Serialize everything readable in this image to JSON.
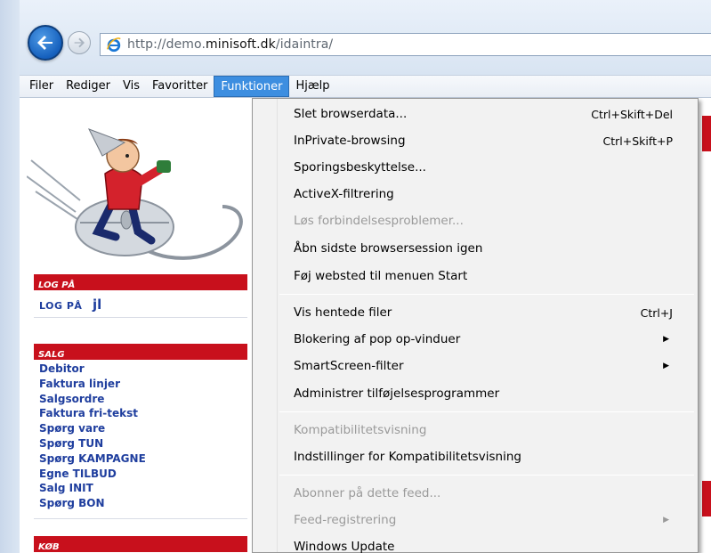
{
  "address": {
    "url_prefix": "http://demo.",
    "url_host": "minisoft.dk",
    "url_path": "/idaintra/"
  },
  "icons": {
    "back": "back-arrow-icon",
    "forward": "forward-arrow-icon",
    "page": "internet-explorer-icon",
    "submenu": "submenu-arrow-icon"
  },
  "menubar": {
    "items": [
      "Filer",
      "Rediger",
      "Vis",
      "Favoritter",
      "Funktioner",
      "Hjælp"
    ],
    "active": "Funktioner"
  },
  "dropdown": {
    "items": [
      {
        "label": "Slet browserdata...",
        "shortcut": "Ctrl+Skift+Del"
      },
      {
        "label": "InPrivate-browsing",
        "shortcut": "Ctrl+Skift+P"
      },
      {
        "label": "Sporingsbeskyttelse..."
      },
      {
        "label": "ActiveX-filtrering"
      },
      {
        "label": "Løs forbindelsesproblemer...",
        "disabled": true
      },
      {
        "label": "Åbn sidste browsersession igen"
      },
      {
        "label": "Føj websted til menuen Start"
      },
      {
        "label": "Vis hentede filer",
        "shortcut": "Ctrl+J"
      },
      {
        "label": "Blokering af pop op-vinduer",
        "submenu": true
      },
      {
        "label": "SmartScreen-filter",
        "submenu": true
      },
      {
        "label": "Administrer tilføjelsesprogrammer"
      },
      {
        "label": "Kompatibilitetsvisning",
        "disabled": true
      },
      {
        "label": "Indstillinger for Kompatibilitetsvisning"
      },
      {
        "label": "Abonner på dette feed...",
        "disabled": true
      },
      {
        "label": "Feed-registrering",
        "disabled": true,
        "submenu": true
      },
      {
        "label": "Windows Update"
      }
    ]
  },
  "sidebar": {
    "login_header": "LOG PÅ",
    "login_label": "LOG PÅ",
    "login_user": "jl",
    "sales_header": "SALG",
    "sales_items": [
      "Debitor",
      "Faktura linjer",
      "Salgsordre",
      "Faktura fri-tekst",
      "Spørg vare",
      "Spørg TUN",
      "Spørg KAMPAGNE",
      "Egne TILBUD",
      "Salg INIT",
      "Spørg BON"
    ],
    "buy_header": "KØB"
  },
  "colors": {
    "accent_red": "#c8101c",
    "link_blue": "#1f3e9e",
    "menu_highlight": "#3d8ee0"
  }
}
